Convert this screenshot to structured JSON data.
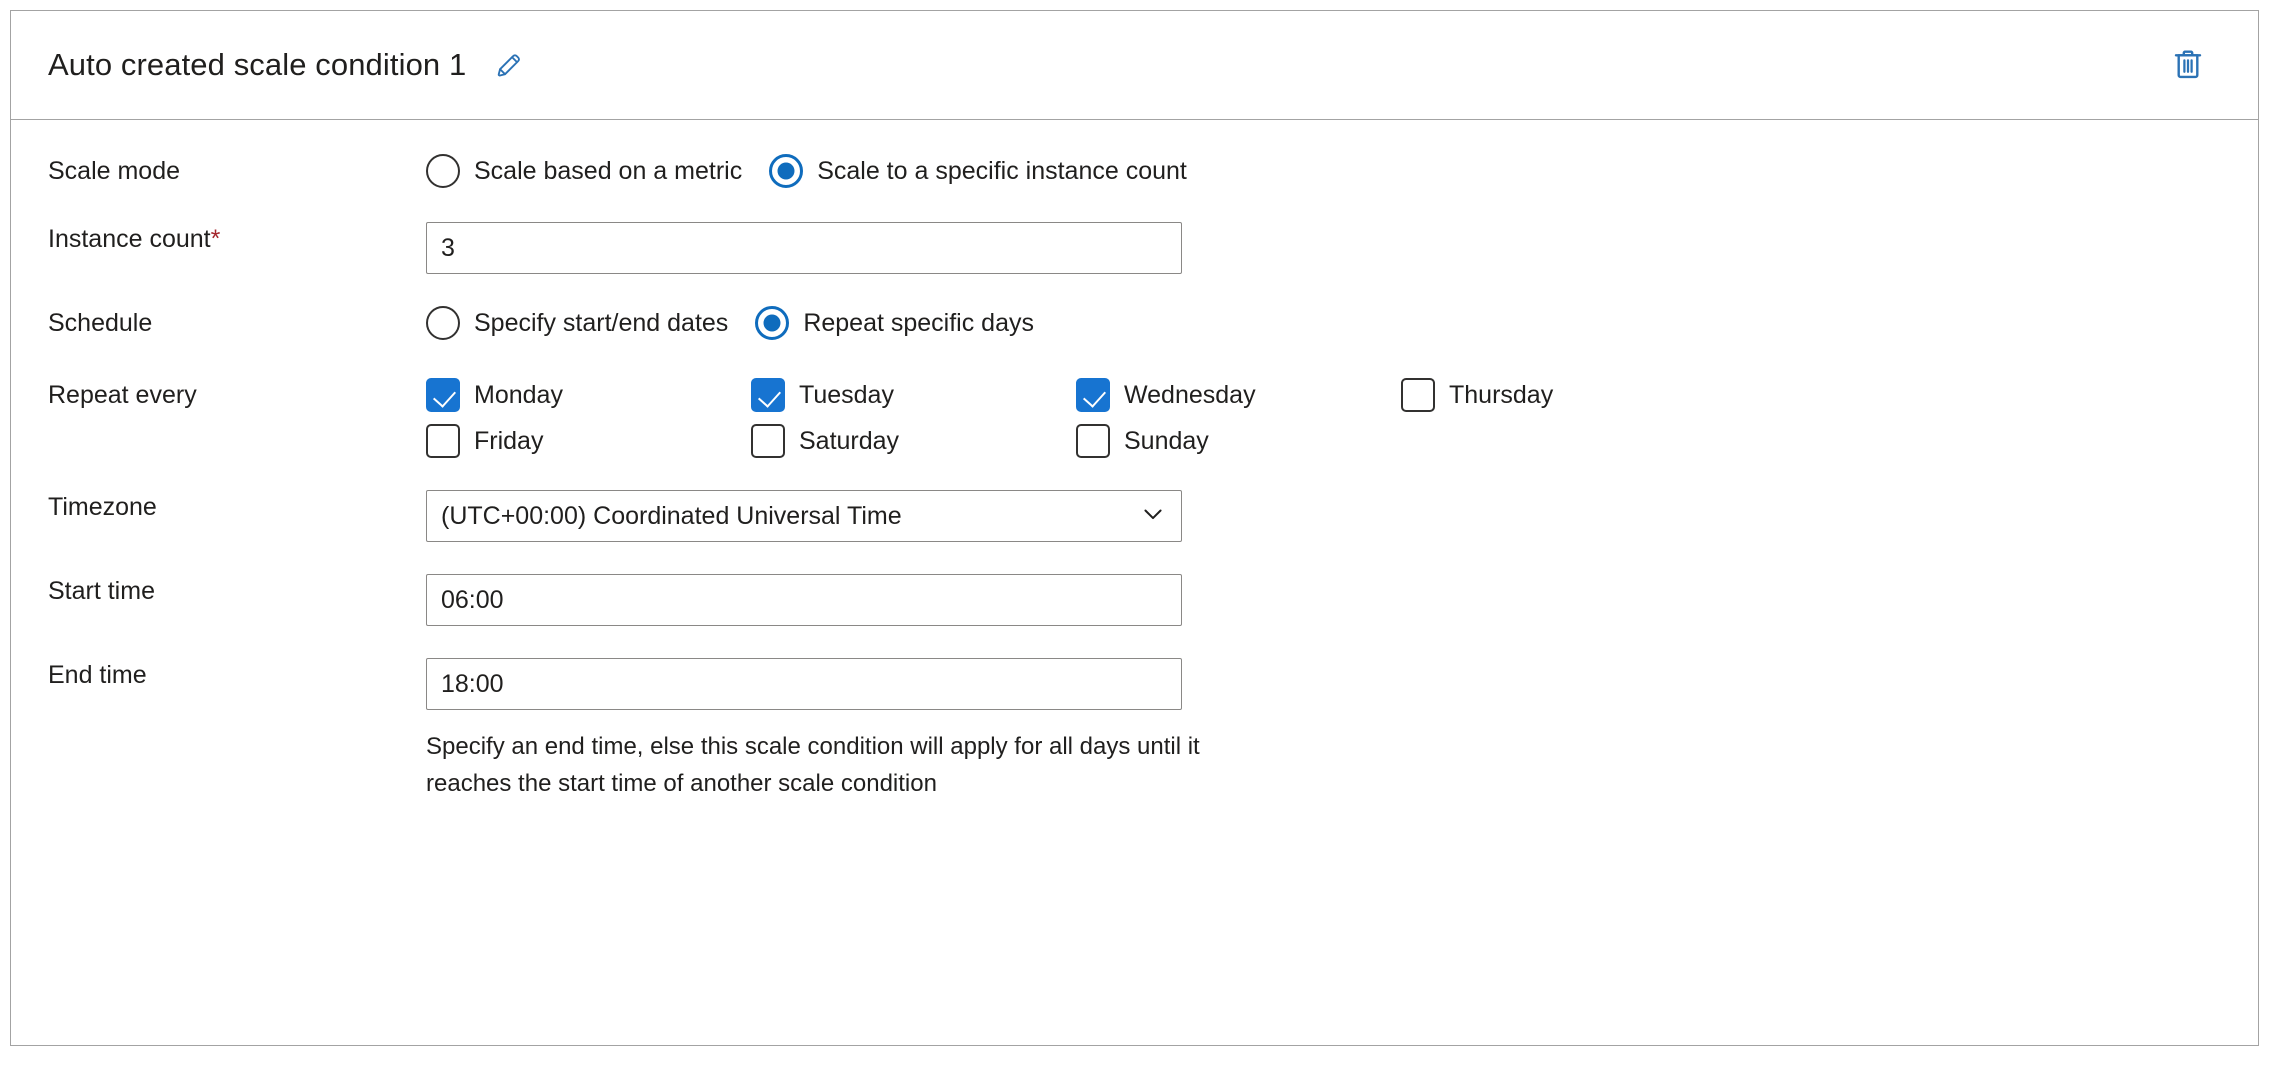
{
  "panel": {
    "title": "Auto created scale condition 1",
    "edit_icon": "pencil-icon",
    "delete_icon": "trash-icon"
  },
  "colors": {
    "accent_blue": "#0f6cbd",
    "checkbox_blue": "#1774d1",
    "icon_blue": "#2b72b5",
    "required_red": "#a4262c",
    "border_gray": "#8a8886",
    "panel_border": "#a3a3a3",
    "text": "#201f1e"
  },
  "rows": {
    "scale_mode": {
      "label": "Scale mode",
      "options": [
        {
          "label": "Scale based on a metric",
          "selected": false
        },
        {
          "label": "Scale to a specific instance count",
          "selected": true
        }
      ]
    },
    "instance_count": {
      "label": "Instance count",
      "required_marker": "*",
      "value": "3",
      "placeholder": ""
    },
    "schedule": {
      "label": "Schedule",
      "options": [
        {
          "label": "Specify start/end dates",
          "selected": false
        },
        {
          "label": "Repeat specific days",
          "selected": true
        }
      ]
    },
    "repeat_every": {
      "label": "Repeat every",
      "days": [
        {
          "label": "Monday",
          "checked": true
        },
        {
          "label": "Tuesday",
          "checked": true
        },
        {
          "label": "Wednesday",
          "checked": true
        },
        {
          "label": "Thursday",
          "checked": false
        },
        {
          "label": "Friday",
          "checked": false
        },
        {
          "label": "Saturday",
          "checked": false
        },
        {
          "label": "Sunday",
          "checked": false
        }
      ]
    },
    "timezone": {
      "label": "Timezone",
      "value": "(UTC+00:00) Coordinated Universal Time",
      "chevron_icon": "chevron-down-icon"
    },
    "start_time": {
      "label": "Start time",
      "value": "06:00"
    },
    "end_time": {
      "label": "End time",
      "value": "18:00",
      "helper_line_1": "Specify an end time, else this scale condition will apply for all days until it",
      "helper_line_2": "reaches the start time of another scale condition"
    }
  }
}
